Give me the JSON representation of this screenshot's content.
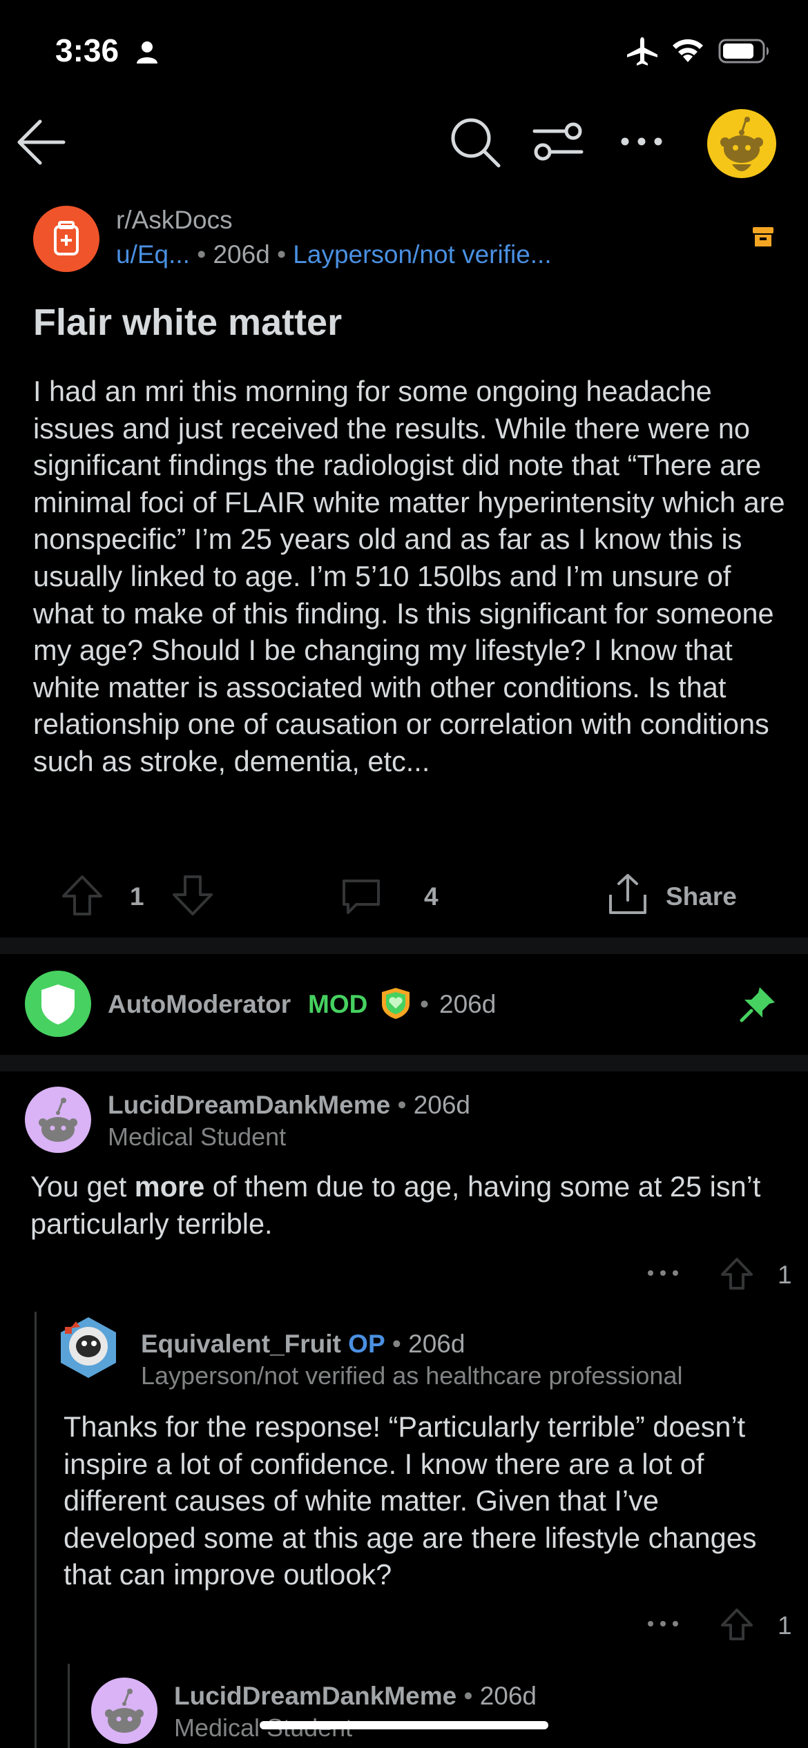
{
  "status_bar": {
    "time": "3:36"
  },
  "post": {
    "subreddit": "r/AskDocs",
    "author": "u/Eq...",
    "age": "206d",
    "flair": "Layperson/not verifie...",
    "title": "Flair white matter",
    "body": "I had an mri this morning for some ongoing headache issues and just received the results. While there were no significant findings the radiologist did note that “There are minimal foci of FLAIR white matter hyperintensity which are nonspecific” I’m 25 years old and as far as I know this is usually linked to age. I’m 5’10 150lbs and I’m unsure of what to make of this finding. Is this significant for someone my age? Should I be changing my lifestyle? I know that white matter is associated with other conditions. Is that relationship one of causation or correlation with conditions such as stroke, dementia, etc...",
    "votes": "1",
    "comments": "4",
    "share_label": "Share"
  },
  "automod": {
    "name": "AutoModerator",
    "badge": "MOD",
    "age": "206d"
  },
  "comments": [
    {
      "user": "LucidDreamDankMeme",
      "age": "206d",
      "flair": "Medical Student",
      "body_pre": "You get ",
      "body_bold": "more",
      "body_post": " of them due to age, having some at 25 isn’t particularly terrible.",
      "votes": "1"
    },
    {
      "user": "Equivalent_Fruit",
      "op": "OP",
      "age": "206d",
      "flair": "Layperson/not verified as healthcare professional",
      "body": "Thanks for the response! “Particularly terrible” doesn’t inspire a lot of confidence. I know there are a lot of different causes of white matter. Given that I’ve developed some at this age are there lifestyle changes that can improve outlook?",
      "votes": "1"
    },
    {
      "user": "LucidDreamDankMeme",
      "age": "206d",
      "flair": "Medical Student"
    }
  ],
  "colors": {
    "link": "#4a90e2",
    "mod_green": "#46d160",
    "subreddit_icon": "#f0542a",
    "avatar_yellow": "#f5c518"
  }
}
